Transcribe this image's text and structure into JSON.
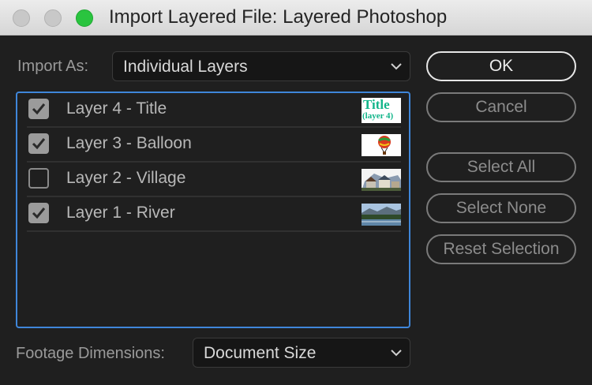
{
  "window": {
    "title": "Import Layered File: Layered Photoshop"
  },
  "import_as": {
    "label": "Import As:",
    "value": "Individual Layers"
  },
  "layers": [
    {
      "label": "Layer 4 - Title",
      "checked": true,
      "thumb": "title-text",
      "thumb_text_1": "Title",
      "thumb_text_2": "(layer 4)"
    },
    {
      "label": "Layer 3 - Balloon",
      "checked": true,
      "thumb": "balloon"
    },
    {
      "label": "Layer 2 - Village",
      "checked": false,
      "thumb": "village"
    },
    {
      "label": "Layer 1 - River",
      "checked": true,
      "thumb": "river"
    }
  ],
  "footage_dimensions": {
    "label": "Footage Dimensions:",
    "value": "Document Size"
  },
  "buttons": {
    "ok": "OK",
    "cancel": "Cancel",
    "select_all": "Select All",
    "select_none": "Select None",
    "reset_selection": "Reset Selection"
  },
  "colors": {
    "accent": "#3f86d9",
    "zoom_button": "#2ac43f"
  }
}
